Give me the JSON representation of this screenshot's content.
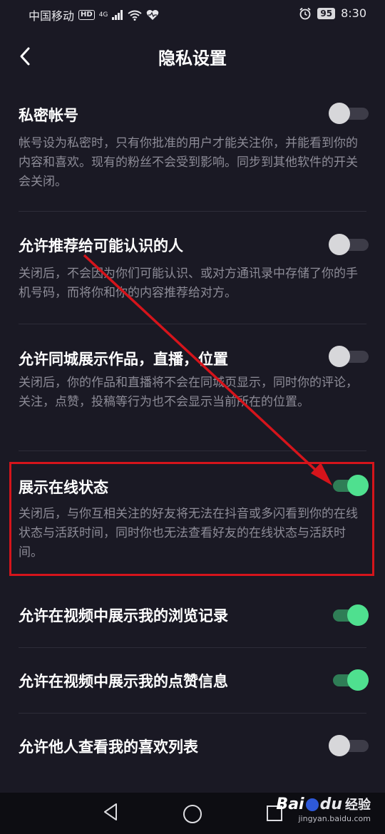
{
  "status_bar": {
    "carrier": "中国移动",
    "hd": "HD",
    "network": "4G",
    "battery": "95",
    "time": "8:30"
  },
  "header": {
    "title": "隐私设置",
    "back_icon": "chevron-left-icon"
  },
  "settings": [
    {
      "title": "私密帐号",
      "desc": "帐号设为私密时，只有你批准的用户才能关注你，并能看到你的内容和喜欢。现有的粉丝不会受到影响。同步到其他软件的开关会关闭。",
      "enabled": false
    },
    {
      "title": "允许推荐给可能认识的人",
      "desc": "关闭后，不会因为你们可能认识、或对方通讯录中存储了你的手机号码，而将你和你的内容推荐给对方。",
      "enabled": false
    },
    {
      "title": "允许同城展示作品，直播，位置",
      "desc": "关闭后，你的作品和直播将不会在同城页显示，同时你的评论，关注，点赞，投稿等行为也不会显示当前所在的位置。",
      "enabled": false
    },
    {
      "title": "展示在线状态",
      "desc": "关闭后，与你互相关注的好友将无法在抖音或多闪看到你的在线状态与活跃时间，同时你也无法查看好友的在线状态与活跃时间。",
      "enabled": true
    },
    {
      "title": "允许在视频中展示我的浏览记录",
      "enabled": true
    },
    {
      "title": "允许在视频中展示我的点赞信息",
      "enabled": true
    },
    {
      "title": "允许他人查看我的喜欢列表",
      "enabled": false
    }
  ],
  "colors": {
    "background": "#1a1924",
    "toggle_on": "#4fe08f",
    "toggle_off": "#d7d7da",
    "annotation": "#d5141b"
  },
  "watermark": {
    "brand_bai": "Bai",
    "brand_du": "du",
    "brand_word": "经验",
    "url": "jingyan.baidu.com"
  },
  "nav_bar": {
    "back_icon": "triangle-back-icon",
    "home_icon": "circle-home-icon",
    "recent_icon": "square-recent-icon"
  }
}
